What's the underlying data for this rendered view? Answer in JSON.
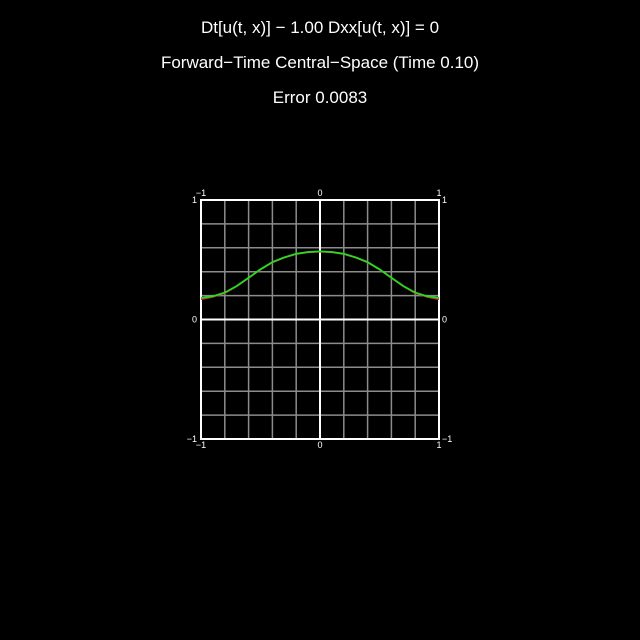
{
  "header": {
    "equation": "Dt[u(t, x)] − 1.00 Dxx[u(t, x)] = 0",
    "method": "Forward−Time Central−Space (Time 0.10)",
    "error": "Error 0.0083"
  },
  "colors": {
    "background": "#000000",
    "grid": "#8c8c8c",
    "axes": "#ffffff",
    "numerical": "#22dd22",
    "exact": "#dd2222"
  },
  "chart_data": {
    "type": "line",
    "title": "",
    "xlabel": "",
    "ylabel": "",
    "xlim": [
      -1,
      1
    ],
    "ylim": [
      -1,
      1
    ],
    "grid": true,
    "x_ticks": [
      "−1",
      "0",
      "1"
    ],
    "y_ticks_left": [
      "1",
      "0",
      "−1"
    ],
    "y_ticks_right": [
      "1",
      "0",
      "−1"
    ],
    "x": [
      -1.0,
      -0.9,
      -0.8,
      -0.7,
      -0.6,
      -0.5,
      -0.4,
      -0.3,
      -0.2,
      -0.1,
      0.0,
      0.1,
      0.2,
      0.3,
      0.4,
      0.5,
      0.6,
      0.7,
      0.8,
      0.9,
      1.0
    ],
    "series": [
      {
        "values": [
          0.18,
          0.195,
          0.225,
          0.28,
          0.35,
          0.42,
          0.48,
          0.52,
          0.55,
          0.565,
          0.57,
          0.565,
          0.55,
          0.52,
          0.48,
          0.42,
          0.35,
          0.28,
          0.225,
          0.195,
          0.18
        ]
      },
      {
        "values": [
          0.17,
          0.19,
          0.222,
          0.278,
          0.348,
          0.418,
          0.478,
          0.518,
          0.548,
          0.563,
          0.568,
          0.563,
          0.548,
          0.518,
          0.478,
          0.418,
          0.348,
          0.278,
          0.222,
          0.19,
          0.17
        ]
      }
    ]
  }
}
